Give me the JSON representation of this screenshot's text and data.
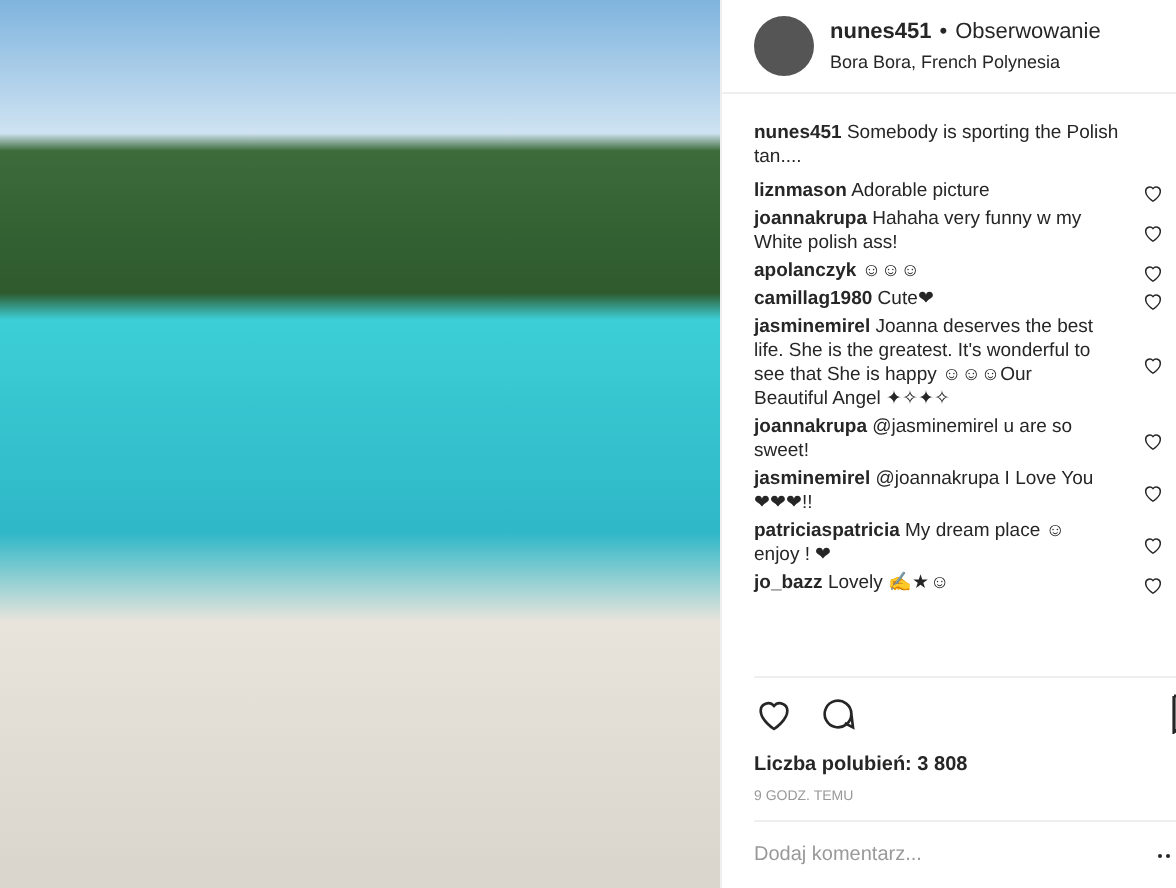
{
  "post": {
    "username": "nunes451",
    "separator": "•",
    "follow": "Obserwowanie",
    "location": "Bora Bora, French Polynesia"
  },
  "caption": {
    "user": "nunes451",
    "text": "Somebody is sporting the Polish tan...."
  },
  "comments": [
    {
      "user": "liznmason",
      "text": "Adorable picture"
    },
    {
      "user": "joannakrupa",
      "text": "Hahaha very funny w my White polish ass!"
    },
    {
      "user": "apolanczyk",
      "text": "☺☺☺"
    },
    {
      "user": "camillag1980",
      "text": "Cute❤"
    },
    {
      "user": "jasminemirel",
      "text": "Joanna deserves the best life. She is the greatest. It's wonderful to see that She is happy ☺☺☺Our Beautiful Angel ✦✧✦✧"
    },
    {
      "user": "joannakrupa",
      "text": "@jasminemirel u are so sweet!"
    },
    {
      "user": "jasminemirel",
      "text": "@joannakrupa I Love You❤❤❤!!"
    },
    {
      "user": "patriciaspatricia",
      "text": "My dream place ☺ enjoy ! ❤"
    },
    {
      "user": "jo_bazz",
      "text": "Lovely ✍★☺"
    }
  ],
  "likes": "Liczba polubień: 3 808",
  "time": "9 GODZ. TEMU",
  "comment_field": {
    "placeholder": "Dodaj komentarz..."
  }
}
